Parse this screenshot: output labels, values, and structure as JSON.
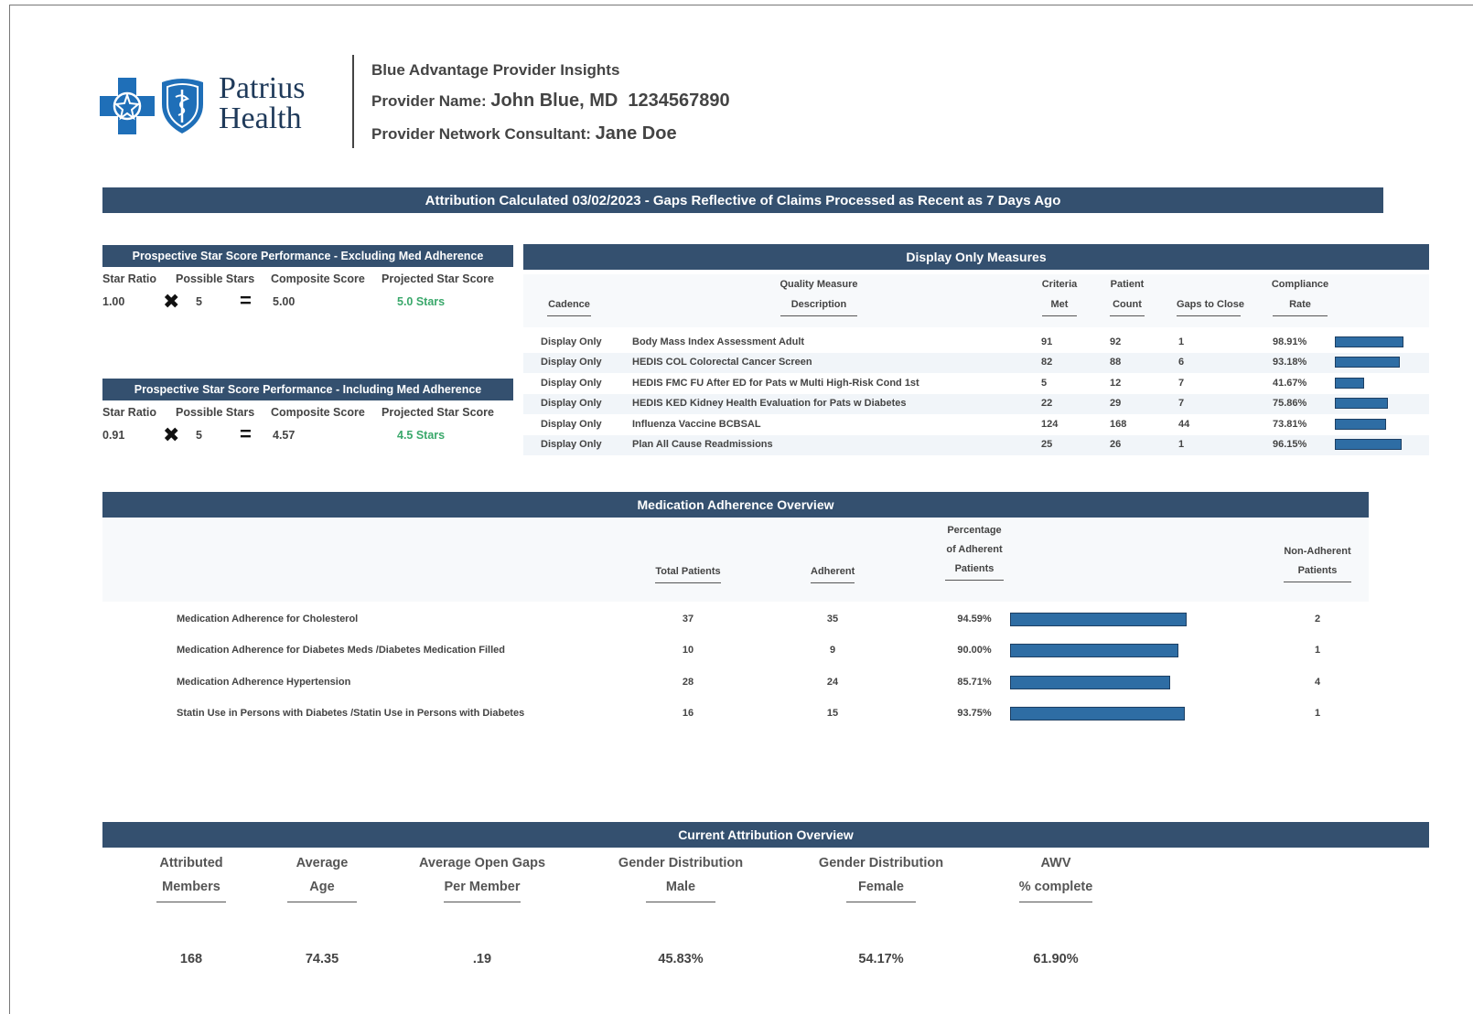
{
  "header": {
    "logo_name_line1": "Patrius",
    "logo_name_line2": "Health",
    "title": "Blue Advantage Provider Insights",
    "provider_label": "Provider Name:",
    "provider_value": "John Blue, MD  1234567890",
    "consultant_label": "Provider Network Consultant:",
    "consultant_value": "Jane Doe"
  },
  "attribution_banner": "Attribution Calculated 03/02/2023 - Gaps Reflective of Claims Processed as Recent as 7 Days Ago",
  "star_excluding": {
    "title": "Prospective Star Score Performance - Excluding Med Adherence",
    "headers": [
      "Star Ratio",
      "Possible Stars",
      "Composite Score",
      "Projected Star Score"
    ],
    "star_ratio": "1.00",
    "possible_stars": "5",
    "composite_score": "5.00",
    "projected": "5.0 Stars"
  },
  "star_including": {
    "title": "Prospective Star Score Performance - Including Med Adherence",
    "headers": [
      "Star Ratio",
      "Possible Stars",
      "Composite Score",
      "Projected Star Score"
    ],
    "star_ratio": "0.91",
    "possible_stars": "5",
    "composite_score": "4.57",
    "projected": "4.5 Stars"
  },
  "display_measures": {
    "title": "Display Only Measures",
    "col_cadence": "Cadence",
    "col_qm_line1": "Quality Measure",
    "col_qm_line2": "Description",
    "col_criteria_line1": "Criteria",
    "col_criteria_line2": "Met",
    "col_patient_line1": "Patient",
    "col_patient_line2": "Count",
    "col_gaps": "Gaps to Close",
    "col_compliance_line1": "Compliance",
    "col_compliance_line2": "Rate",
    "rows": [
      {
        "cadence": "Display Only",
        "desc": "Body Mass Index Assessment Adult",
        "met": "91",
        "count": "92",
        "gaps": "1",
        "rate": "98.91%",
        "rate_value": 98.91
      },
      {
        "cadence": "Display Only",
        "desc": "HEDIS COL Colorectal Cancer Screen",
        "met": "82",
        "count": "88",
        "gaps": "6",
        "rate": "93.18%",
        "rate_value": 93.18
      },
      {
        "cadence": "Display Only",
        "desc": "HEDIS FMC FU After ED for Pats w Multi High-Risk Cond 1st",
        "met": "5",
        "count": "12",
        "gaps": "7",
        "rate": "41.67%",
        "rate_value": 41.67
      },
      {
        "cadence": "Display Only",
        "desc": "HEDIS KED Kidney Health Evaluation for Pats w Diabetes",
        "met": "22",
        "count": "29",
        "gaps": "7",
        "rate": "75.86%",
        "rate_value": 75.86
      },
      {
        "cadence": "Display Only",
        "desc": "Influenza Vaccine BCBSAL",
        "met": "124",
        "count": "168",
        "gaps": "44",
        "rate": "73.81%",
        "rate_value": 73.81
      },
      {
        "cadence": "Display Only",
        "desc": "Plan All Cause Readmissions",
        "met": "25",
        "count": "26",
        "gaps": "1",
        "rate": "96.15%",
        "rate_value": 96.15
      }
    ]
  },
  "med_adherence": {
    "title": "Medication Adherence Overview",
    "col_total": "Total Patients",
    "col_adherent": "Adherent",
    "col_pct_line1": "Percentage",
    "col_pct_line2": "of Adherent",
    "col_pct_line3": "Patients",
    "col_non_line1": "Non-Adherent",
    "col_non_line2": "Patients",
    "rows": [
      {
        "measure": "Medication Adherence for Cholesterol",
        "total": "37",
        "adherent": "35",
        "pct": "94.59%",
        "pct_value": 94.59,
        "non": "2"
      },
      {
        "measure": "Medication Adherence for Diabetes Meds /Diabetes Medication Filled",
        "total": "10",
        "adherent": "9",
        "pct": "90.00%",
        "pct_value": 90.0,
        "non": "1"
      },
      {
        "measure": "Medication Adherence Hypertension",
        "total": "28",
        "adherent": "24",
        "pct": "85.71%",
        "pct_value": 85.71,
        "non": "4"
      },
      {
        "measure": "Statin Use in Persons with Diabetes /Statin Use in Persons with Diabetes",
        "total": "16",
        "adherent": "15",
        "pct": "93.75%",
        "pct_value": 93.75,
        "non": "1"
      }
    ]
  },
  "attribution_overview": {
    "title": "Current Attribution Overview",
    "columns": [
      {
        "line1": "Attributed",
        "line2": "Members",
        "value": "168"
      },
      {
        "line1": "Average",
        "line2": "Age",
        "value": "74.35"
      },
      {
        "line1": "Average Open Gaps",
        "line2": "Per Member",
        "value": ".19"
      },
      {
        "line1": "Gender Distribution",
        "line2": "Male",
        "value": "45.83%"
      },
      {
        "line1": "Gender Distribution",
        "line2": "Female",
        "value": "54.17%"
      },
      {
        "line1": "AWV",
        "line2": "% complete",
        "value": "61.90%"
      }
    ]
  },
  "colors": {
    "banner": "#34506f",
    "bar": "#2e6da4",
    "green": "#3aa86b"
  }
}
